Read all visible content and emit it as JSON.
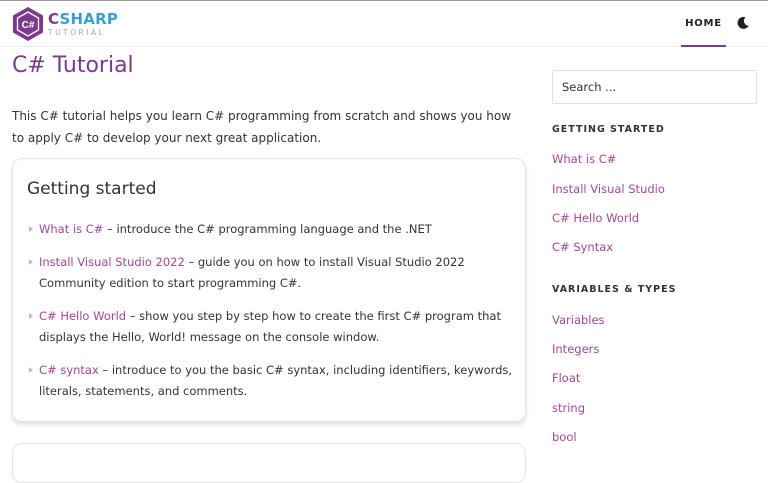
{
  "colors": {
    "brand": "#7b3a8e",
    "link": "#a0489b",
    "logo_accent": "#3b9ed3"
  },
  "header": {
    "logo_glyph": "C#",
    "logo_title_part1": "C",
    "logo_title_part2": "SHARP",
    "logo_subtitle": "TUTORIAL",
    "nav_home": "HOME",
    "theme_icon": "moon-icon"
  },
  "main": {
    "title": "C# Tutorial",
    "intro": "This C# tutorial helps you learn C# programming from scratch and shows you how to apply C# to develop your next great application.",
    "card": {
      "title": "Getting started",
      "items": [
        {
          "link": "What is C#",
          "text": " – introduce the C# programming language and the .NET"
        },
        {
          "link": "Install Visual Studio 2022",
          "text": " – guide you on how to install Visual Studio 2022 Community edition to start programming C#."
        },
        {
          "link": "C# Hello World",
          "text": " – show you step by step how to create the first C# program that displays the Hello, World! message on the console window."
        },
        {
          "link": "C# syntax",
          "text": " – introduce to you the basic C# syntax, including identifiers, keywords, literals, statements, and comments."
        }
      ]
    }
  },
  "sidebar": {
    "search_placeholder": "Search ...",
    "sections": [
      {
        "heading": "GETTING STARTED",
        "links": [
          "What is C#",
          "Install Visual Studio",
          "C# Hello World",
          "C# Syntax"
        ]
      },
      {
        "heading": "VARIABLES & TYPES",
        "links": [
          "Variables",
          "Integers",
          "Float",
          "string",
          "bool"
        ]
      }
    ]
  }
}
